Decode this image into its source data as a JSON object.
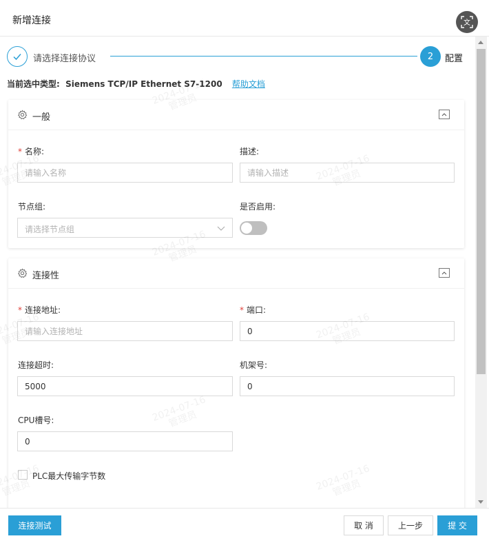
{
  "dialog": {
    "title": "新增连接"
  },
  "steps": {
    "step1_label": "请选择连接协议",
    "step2_number": "2",
    "step2_label": "配置"
  },
  "type_info": {
    "text": "当前选中类型:  Siemens TCP/IP Ethernet S7-1200",
    "help_link": "帮助文档"
  },
  "general": {
    "title": "一般",
    "name_label": "名称:",
    "name_placeholder": "请输入名称",
    "desc_label": "描述:",
    "desc_placeholder": "请输入描述",
    "node_group_label": "节点组:",
    "node_group_placeholder": "请选择节点组",
    "enabled_label": "是否启用:",
    "enabled": false
  },
  "connectivity": {
    "title": "连接性",
    "address_label": "连接地址:",
    "address_placeholder": "请输入连接地址",
    "port_label": "端口:",
    "port_value": "0",
    "timeout_label": "连接超时:",
    "timeout_value": "5000",
    "rack_label": "机架号:",
    "rack_value": "0",
    "cpu_slot_label": "CPU槽号:",
    "cpu_slot_value": "0",
    "plc_max_bytes_label": "PLC最大传输字节数"
  },
  "footer": {
    "test_button": "连接测试",
    "cancel_button": "取 消",
    "prev_button": "上一步",
    "submit_button": "提 交"
  },
  "watermark": {
    "date": "2024-07-16",
    "user": "管理员"
  },
  "colors": {
    "primary": "#2a9fd6",
    "required": "#e0413a"
  },
  "icons": [
    "translate-icon",
    "check-icon",
    "gear-icon",
    "chevron-up-icon",
    "chevron-down-icon"
  ]
}
